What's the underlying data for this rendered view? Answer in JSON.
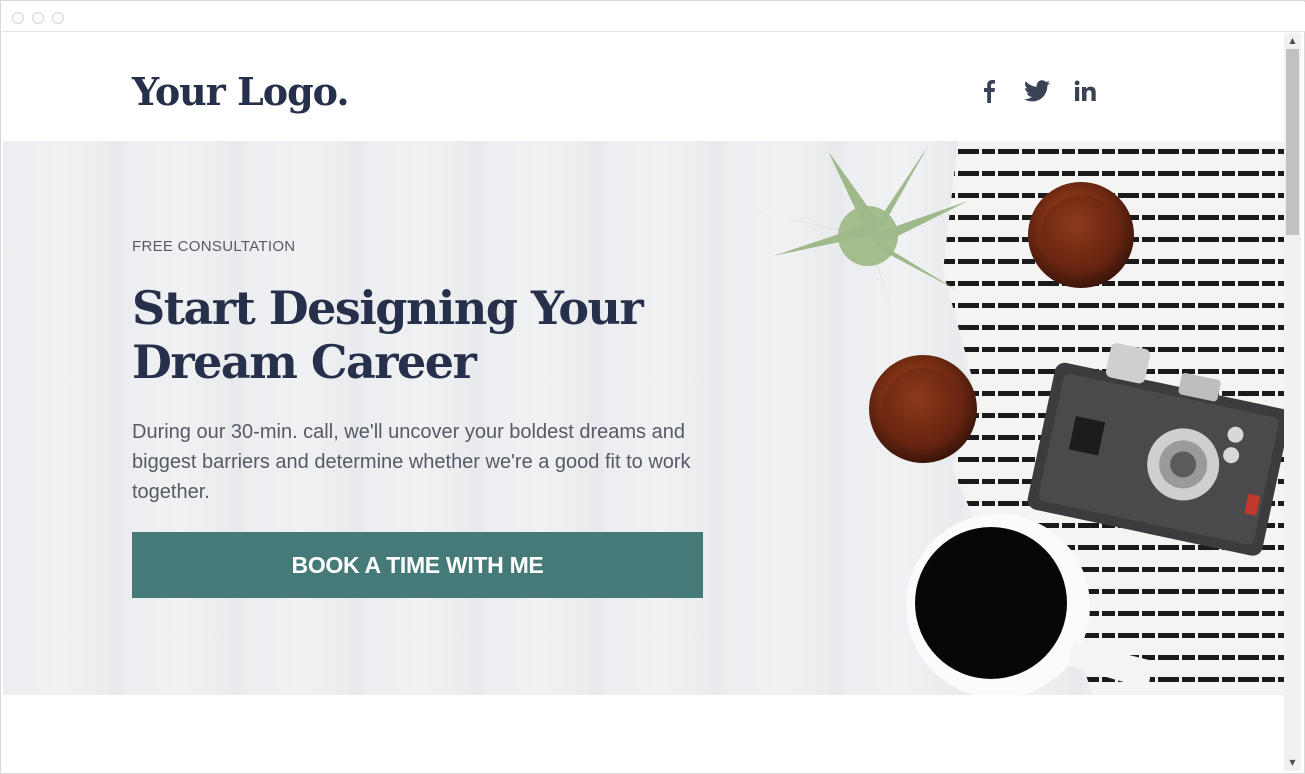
{
  "header": {
    "logo": "Your Logo.",
    "social": [
      {
        "icon": "facebook-icon"
      },
      {
        "icon": "twitter-icon"
      },
      {
        "icon": "linkedin-icon"
      }
    ]
  },
  "hero": {
    "eyebrow": "FREE CONSULTATION",
    "headline": "Start Designing Your Dream Career",
    "body": "During our 30-min. call, we'll uncover your boldest dreams and biggest barriers and determine whether we're a good fit to work together.",
    "cta_label": "BOOK A TIME WITH ME"
  },
  "colors": {
    "brand_text": "#26304a",
    "accent": "#467a79",
    "hero_background": "#ecedf0"
  }
}
